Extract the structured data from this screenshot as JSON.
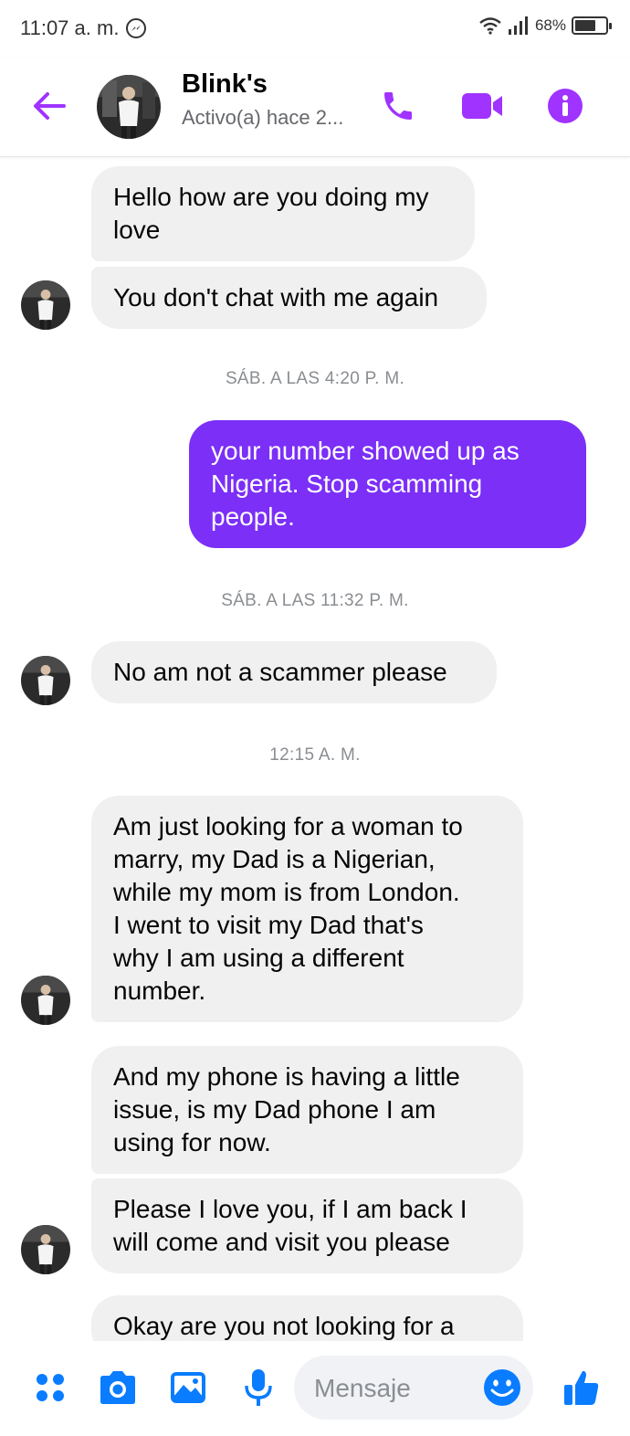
{
  "status_bar": {
    "time": "11:07 a. m.",
    "battery": "68%",
    "battery_level": 0.68,
    "icons": [
      "messenger-icon",
      "wifi-icon",
      "signal-icon",
      "battery-icon"
    ]
  },
  "header": {
    "name": "Blink's",
    "status": "Activo(a) hace 2...",
    "icons": [
      "back-arrow-icon",
      "phone-icon",
      "video-camera-icon",
      "info-icon"
    ],
    "accent_color": "#a033ff"
  },
  "messages": [
    {
      "type": "in",
      "text_lines": [
        "Hello how are you doing my",
        "love"
      ]
    },
    {
      "type": "in",
      "text_lines": [
        "You don't chat with me again"
      ]
    },
    {
      "type": "timestamp",
      "text": "SÁB. A LAS 4:20 P. M."
    },
    {
      "type": "out",
      "text_lines": [
        "your number showed up as",
        "Nigeria. Stop scamming",
        "people."
      ]
    },
    {
      "type": "timestamp",
      "text": "SÁB. A LAS 11:32 P. M."
    },
    {
      "type": "in",
      "text_lines": [
        "No am not a scammer please"
      ]
    },
    {
      "type": "timestamp",
      "text": "12:15 A. M."
    },
    {
      "type": "in",
      "text_lines": [
        "Am just looking for a woman to",
        "marry, my Dad is a Nigerian,",
        "while my mom is from London.",
        "I went to visit my Dad that's",
        "why I am using a different",
        "number."
      ]
    },
    {
      "type": "in",
      "text_lines": [
        "And my phone is having a little",
        "issue, is my Dad phone I am",
        "using for now."
      ]
    },
    {
      "type": "in",
      "text_lines": [
        "Please I love you, if I am back I",
        "will come and visit you please"
      ]
    },
    {
      "type": "in",
      "text_lines": [
        "Okay are you not looking for a"
      ]
    }
  ],
  "composer": {
    "placeholder": "Mensaje",
    "icons": [
      "menu-dots-icon",
      "camera-icon",
      "gallery-icon",
      "microphone-icon",
      "emoji-icon",
      "thumbs-up-icon"
    ],
    "icon_color": "#0a7cff"
  },
  "colors": {
    "outgoing_bubble": "#7b2ff7",
    "incoming_bubble": "#f0f0f0",
    "timestamp_text": "#8a8d91"
  }
}
